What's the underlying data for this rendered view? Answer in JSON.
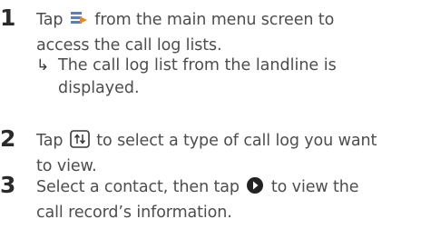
{
  "steps": [
    {
      "number": "1",
      "line1_before": "Tap ",
      "line1_after": " from the main menu screen to",
      "line2": "access the call log lists.",
      "icon": "call-log-menu-icon",
      "result_arrow": "↳",
      "result_line1": "The call log list from the landline is",
      "result_line2": "displayed."
    },
    {
      "number": "2",
      "line1_before": "Tap ",
      "line1_after": " to select a type of call log you want",
      "line2": "to view.",
      "icon": "switch-log-type-icon"
    },
    {
      "number": "3",
      "line1_before": "Select a contact, then tap ",
      "line1_after": " to view the",
      "line2": "call record’s information.",
      "icon": "play-arrow-icon"
    }
  ],
  "colors": {
    "text": "#4d4d4d",
    "number": "#2b2b2b",
    "icon_blue": "#5a7fc0",
    "icon_orange": "#e98a1e"
  }
}
